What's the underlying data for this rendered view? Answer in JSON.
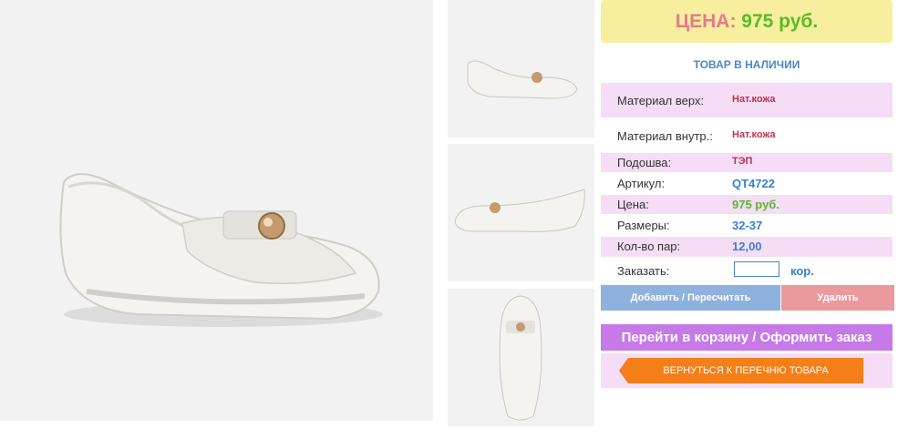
{
  "price_box": {
    "label": "ЦЕНА:",
    "value": "975 руб."
  },
  "stock_status": "ТОВАР В НАЛИЧИИ",
  "specs": {
    "material_upper": {
      "label": "Материал верх:",
      "value": "Нат.кожа"
    },
    "material_inner": {
      "label": "Материал внутр.:",
      "value": "Нат.кожа"
    },
    "sole": {
      "label": "Подошва:",
      "value": "ТЭП"
    },
    "article": {
      "label": "Артикул:",
      "value": "QT4722"
    },
    "price": {
      "label": "Цена:",
      "value": "975 руб."
    },
    "sizes": {
      "label": "Размеры:",
      "value": "32-37"
    },
    "pairs": {
      "label": "Кол-во пар:",
      "value": "12,00"
    },
    "order": {
      "label": "Заказать:",
      "input_value": "",
      "unit": "кор."
    }
  },
  "buttons": {
    "add_recalc": "Добавить / Пересчитать",
    "delete": "Удалить",
    "go_to_cart": "Перейти в корзину / Оформить заказ",
    "back_to_list": "ВЕРНУТЬСЯ К ПЕРЕЧНЮ ТОВАРА"
  },
  "colors": {
    "price_label": "#e8798e",
    "price_value": "#5bb82b",
    "accent_blue": "#3a7fce",
    "accent_red": "#c0334c",
    "row_pink": "#f5ddf6",
    "cart_button": "#c57ae8",
    "back_button": "#f47f18"
  }
}
